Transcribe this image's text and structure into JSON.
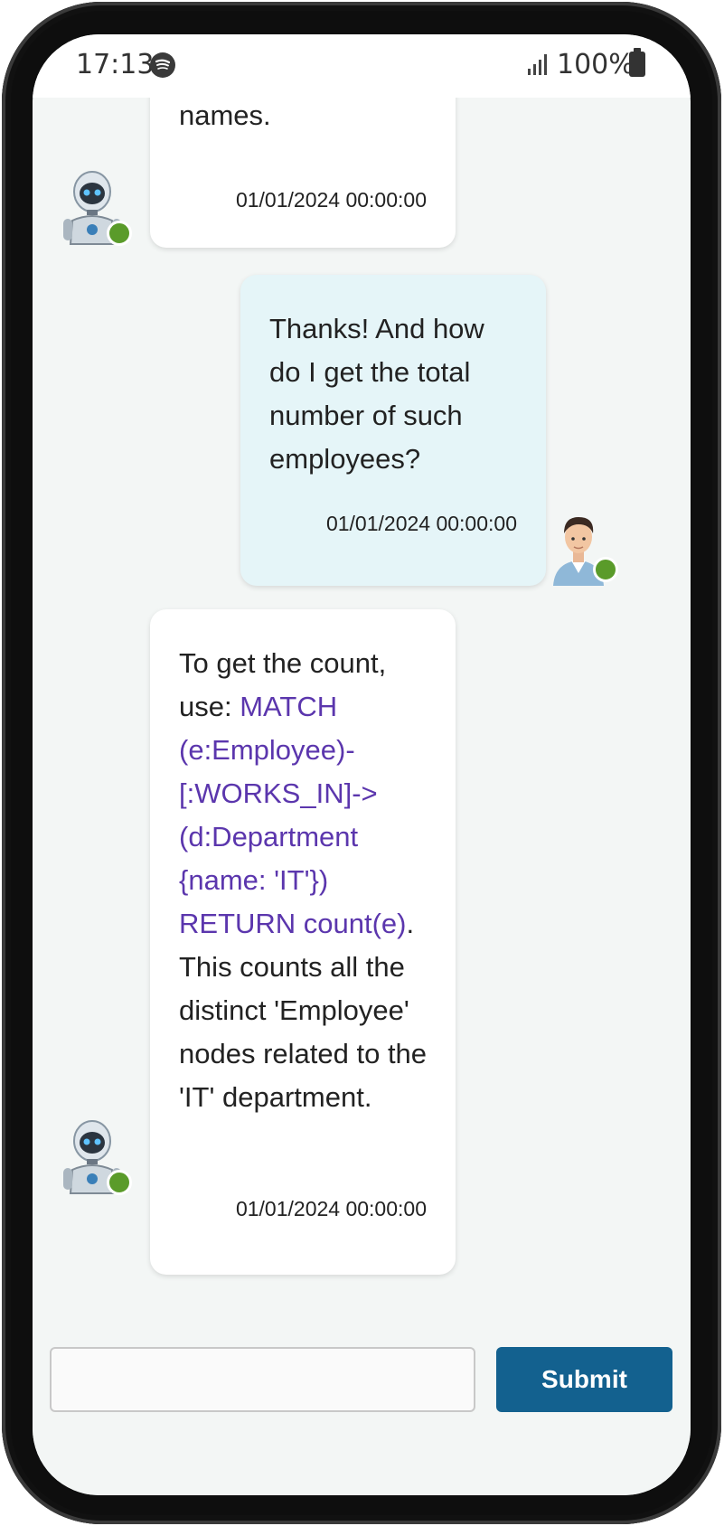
{
  "status_bar": {
    "time": "17:13",
    "battery": "100%",
    "icons": [
      "spotify-icon",
      "signal-icon",
      "battery-icon"
    ]
  },
  "messages": [
    {
      "sender": "bot",
      "text": "names.",
      "timestamp": "01/01/2024 00:00:00"
    },
    {
      "sender": "user",
      "text": "Thanks! And how do I get the total number of such employees?",
      "timestamp": "01/01/2024 00:00:00"
    },
    {
      "sender": "bot",
      "text_before_code": "To get the count, use: ",
      "code": "MATCH (e:Employee)-[:WORKS_IN]->(d:Department {name: 'IT'}) RETURN count(e)",
      "text_after_code": ". This counts all the distinct 'Employee' nodes related to the 'IT' department.",
      "timestamp": "01/01/2024 00:00:00"
    }
  ],
  "composer": {
    "input_value": "",
    "submit_label": "Submit"
  },
  "colors": {
    "bot_bubble": "#ffffff",
    "user_bubble": "#e5f5f8",
    "code_text": "#5b36ad",
    "online_dot": "#5a9b2a",
    "submit_button": "#13618f",
    "chat_background": "#f3f6f5"
  }
}
